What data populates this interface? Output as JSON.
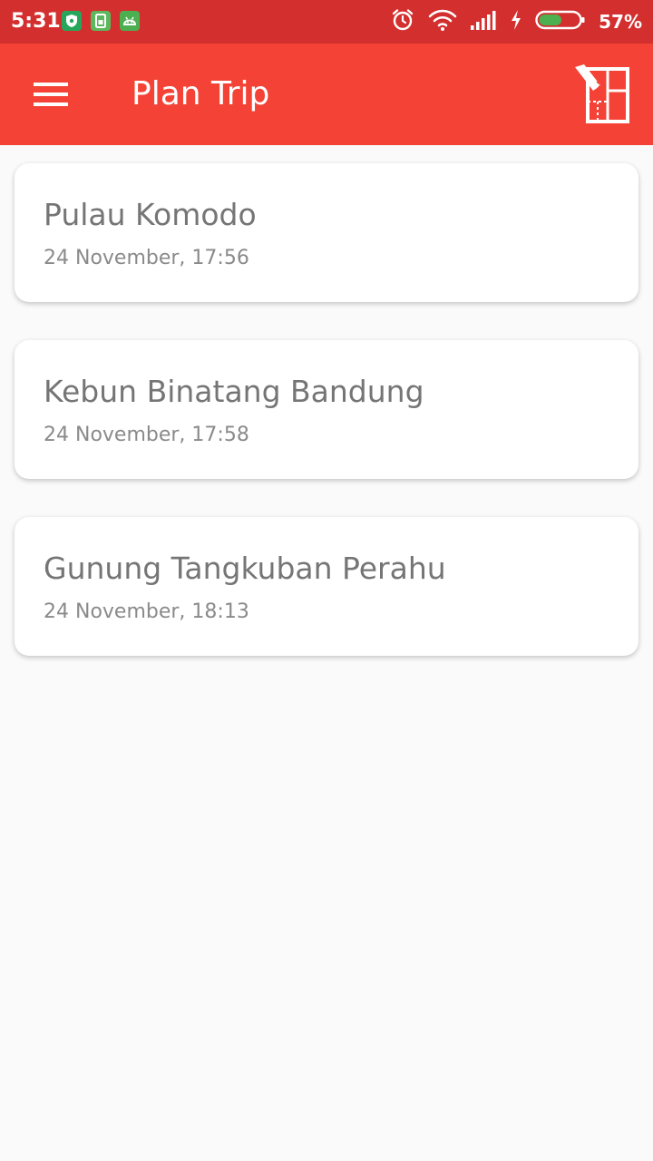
{
  "status_bar": {
    "time": "5:31",
    "battery_percent": "57%",
    "icons": [
      "shield-icon",
      "sim-icon",
      "android-icon",
      "alarm-icon",
      "wifi-icon",
      "signal-icon",
      "charging-icon",
      "battery-icon"
    ],
    "battery_fill_fraction": 0.57
  },
  "app_bar": {
    "title": "Plan Trip",
    "menu_icon": "hamburger-menu-icon",
    "action_icon": "map-icon"
  },
  "trips": [
    {
      "name": "Pulau Komodo",
      "datetime": "24 November, 17:56"
    },
    {
      "name": "Kebun Binatang Bandung",
      "datetime": "24 November, 17:58"
    },
    {
      "name": "Gunung Tangkuban Perahu",
      "datetime": "24 November, 18:13"
    }
  ],
  "colors": {
    "status_bar": "#d32f2f",
    "app_bar": "#f44336",
    "background": "#fafafa",
    "card_title": "#757575",
    "card_subtitle": "#8a8a8a",
    "battery_green": "#4caf50"
  }
}
